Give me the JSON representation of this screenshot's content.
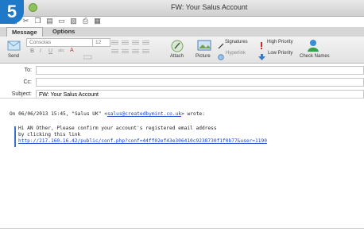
{
  "step": "5",
  "window": {
    "title": "FW: Your Salus Account"
  },
  "tabs": [
    {
      "label": "Message"
    },
    {
      "label": "Options"
    }
  ],
  "ribbon": {
    "send_label": "Send",
    "font_name": "Consolas",
    "font_size": "12",
    "attach_label": "Attach",
    "picture_label": "Picture",
    "signatures_label": "Signatures",
    "hyperlink_label": "Hyperlink",
    "high_priority_label": "High Priority",
    "low_priority_label": "Low Priority",
    "check_names_label": "Check Names"
  },
  "fields": {
    "to_label": "To:",
    "to_value": "",
    "cc_label": "Cc:",
    "cc_value": "",
    "subject_label": "Subject:",
    "subject_value": "FW: Your Salus Account"
  },
  "message": {
    "header_prefix": "On 06/06/2013 15:45, \"Salus UK\" <",
    "header_email": "salus@createdbymint.co.uk",
    "header_suffix": "> wrote:",
    "quote_line1": "Hi AN Other, Please confirm your account's registered email address",
    "quote_line2": "by clicking this link",
    "quote_link": "http://217.160.16.42/public/conf.php?conf=44ff02ef43e306410c9238730f1f0b77&user=1190"
  },
  "colors": {
    "badge": "#1f78c8",
    "link": "#1a44cc",
    "quote_bar": "#3f6fcf"
  }
}
